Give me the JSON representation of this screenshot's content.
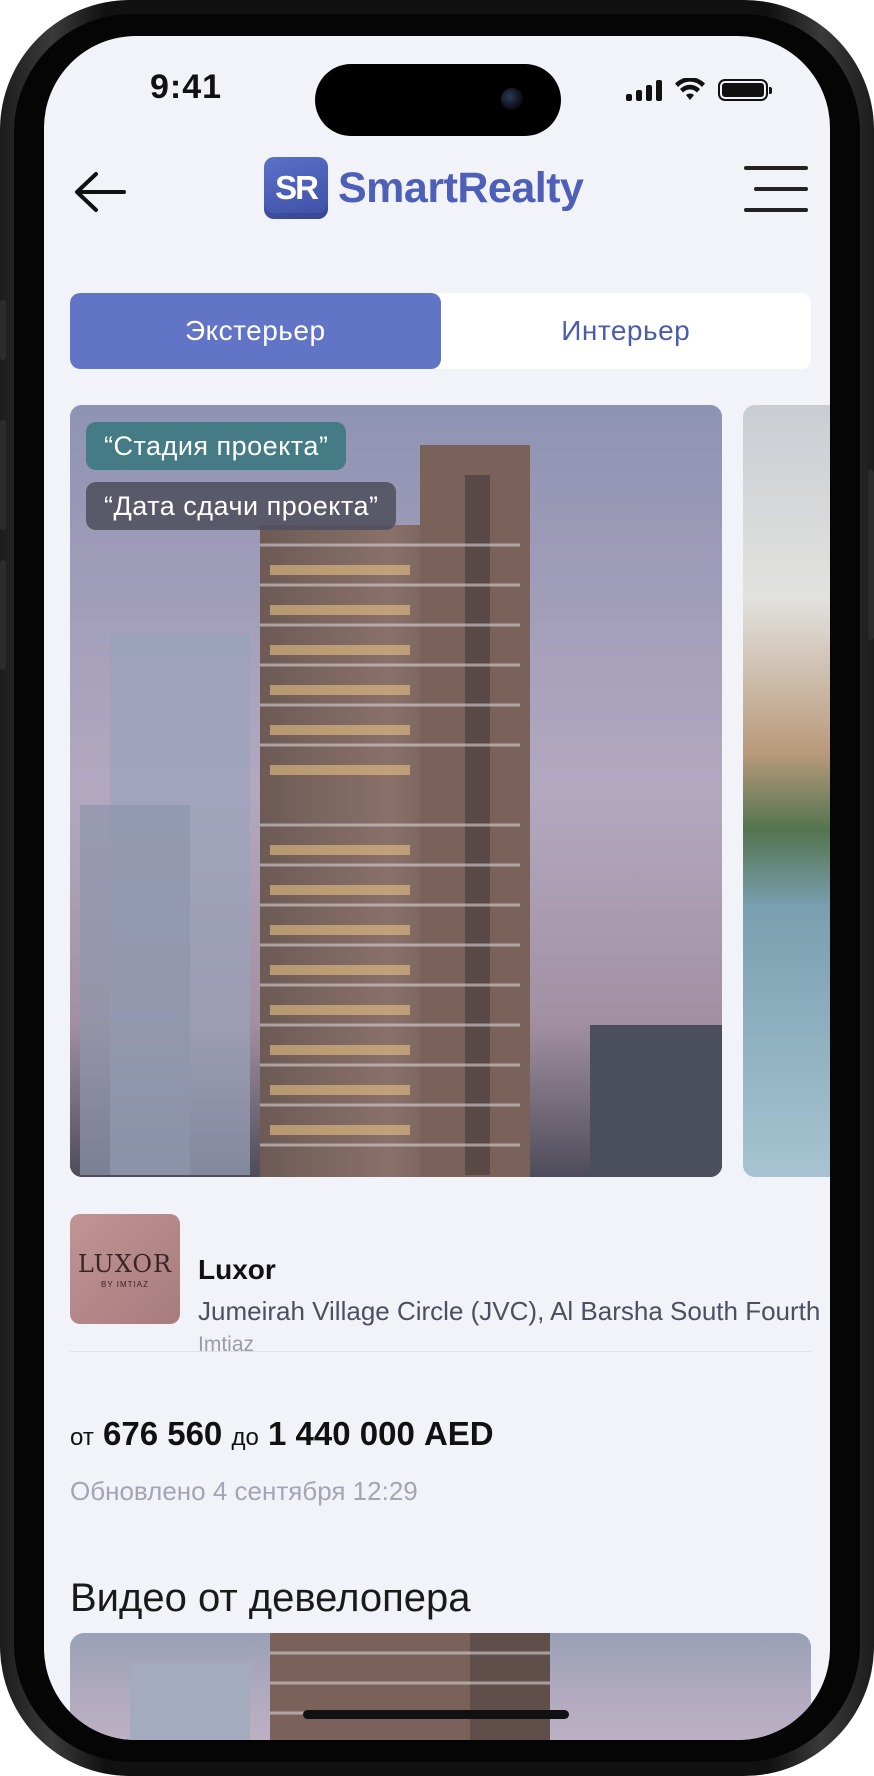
{
  "status_bar": {
    "time": "9:41"
  },
  "header": {
    "logo_mark": "SR",
    "logo_text": "SmartRealty"
  },
  "tabs": [
    {
      "label": "Экстерьер",
      "active": true
    },
    {
      "label": "Интерьер",
      "active": false
    }
  ],
  "gallery": {
    "stage_tag": "“Стадия проекта”",
    "date_tag": "“Дата сдачи проекта”"
  },
  "project": {
    "logo_text": "LUXOR",
    "logo_subtext": "BY IMTIAZ",
    "name": "Luxor",
    "address": "Jumeirah Village Circle (JVC), Al Barsha South Fourth",
    "developer": "Imtiaz"
  },
  "price": {
    "from_label": "от",
    "from_value": "676 560",
    "to_label": "до",
    "to_value": "1 440 000 AED"
  },
  "updated": "Обновлено 4 сентября 12:29",
  "video_section": {
    "title": "Видео от девелопера"
  },
  "colors": {
    "accent": "#6274c6",
    "brand": "#4d5fb8",
    "stage_tag": "#3e7880"
  }
}
